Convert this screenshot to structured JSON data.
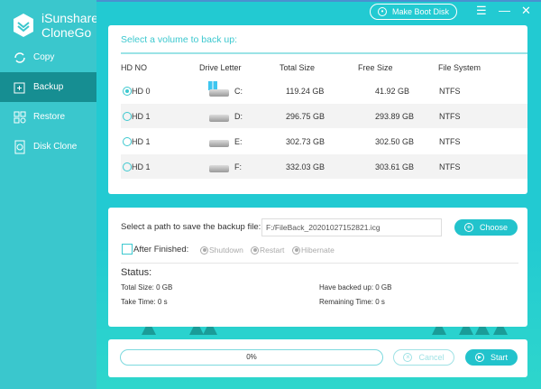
{
  "app": {
    "brand_line1": "iSunshare",
    "brand_line2": "CloneGo",
    "make_boot_disk": "Make Boot Disk"
  },
  "sidebar": {
    "items": [
      {
        "label": "Copy",
        "icon": "sync-icon"
      },
      {
        "label": "Backup",
        "icon": "backup-icon",
        "active": true
      },
      {
        "label": "Restore",
        "icon": "restore-icon"
      },
      {
        "label": "Disk Clone",
        "icon": "disk-clone-icon"
      }
    ]
  },
  "volumes": {
    "title": "Select a volume to back up:",
    "columns": [
      "HD NO",
      "Drive Letter",
      "Total Size",
      "Free Size",
      "File System"
    ],
    "rows": [
      {
        "hd": "HD 0",
        "letter": "C:",
        "total": "119.24 GB",
        "free": "41.92 GB",
        "fs": "NTFS",
        "selected": true,
        "system": true
      },
      {
        "hd": "HD 1",
        "letter": "D:",
        "total": "296.75 GB",
        "free": "293.89 GB",
        "fs": "NTFS"
      },
      {
        "hd": "HD 1",
        "letter": "E:",
        "total": "302.73 GB",
        "free": "302.50 GB",
        "fs": "NTFS"
      },
      {
        "hd": "HD 1",
        "letter": "F:",
        "total": "332.03 GB",
        "free": "303.61 GB",
        "fs": "NTFS"
      }
    ]
  },
  "backup": {
    "path_label": "Select a path to save the backup file:",
    "path_value": "F:/FileBack_20201027152821.icg",
    "choose": "Choose",
    "after_finished": "After Finished:",
    "options": [
      "Shutdown",
      "Restart",
      "Hibernate"
    ]
  },
  "status": {
    "title": "Status:",
    "total_size": "Total Size: 0 GB",
    "have_backed_up": "Have backed up: 0 GB",
    "take_time": "Take Time: 0 s",
    "remaining_time": "Remaining Time: 0 s"
  },
  "progress": {
    "percent": 0,
    "label": "0%",
    "cancel": "Cancel",
    "start": "Start"
  },
  "colors": {
    "accent": "#22c3cc",
    "sidebar": "#3ac7cd",
    "active": "#168e92"
  }
}
